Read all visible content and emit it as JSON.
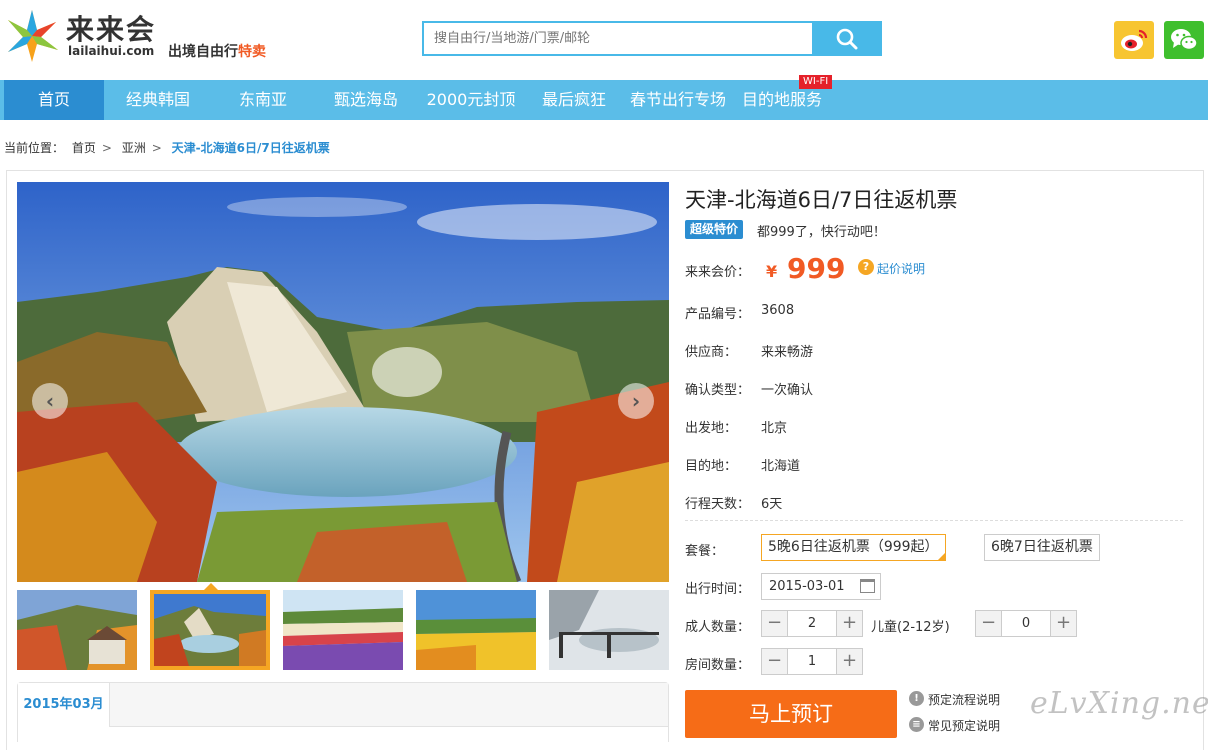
{
  "header": {
    "logo_cn": "来来会",
    "logo_en": "lailaihui.com",
    "slogan_prefix": "出境自由行",
    "slogan_hot": "特卖",
    "search_placeholder": "搜自由行/当地游/门票/邮轮",
    "search_icon": "search-icon",
    "social": [
      "weibo-icon",
      "wechat-icon"
    ]
  },
  "nav": {
    "items": [
      "首页",
      "经典韩国",
      "东南亚",
      "甄选海岛",
      "2000元封顶",
      "最后疯狂",
      "春节出行专场",
      "目的地服务"
    ],
    "active_index": 0,
    "wifi_badge": "WI-FI"
  },
  "breadcrumb": {
    "label": "当前位置：",
    "items": [
      "首页",
      "亚洲",
      "天津-北海道6日/7日往返机票"
    ],
    "sep": ">"
  },
  "product": {
    "title": "天津-北海道6日/7日往返机票",
    "badge": "超级特价",
    "promo": "都999了，快行动吧！",
    "price_label": "来来会价：",
    "price_currency": "¥",
    "price": "999",
    "price_help": "起价说明",
    "fields": [
      {
        "label": "产品编号：",
        "value": "3608"
      },
      {
        "label": "供应商：",
        "value": "来来畅游"
      },
      {
        "label": "确认类型：",
        "value": "一次确认"
      },
      {
        "label": "出发地：",
        "value": "北京"
      },
      {
        "label": "目的地：",
        "value": "北海道"
      },
      {
        "label": "行程天数：",
        "value": "6天"
      }
    ],
    "package_label": "套餐：",
    "packages": [
      "5晚6日往返机票（999起）",
      "6晚7日往返机票"
    ],
    "date_label": "出行时间：",
    "date_value": "2015-03-01",
    "adult_label": "成人数量：",
    "adult_count": "2",
    "child_label": "儿童(2-12岁)",
    "child_count": "0",
    "room_label": "房间数量：",
    "room_count": "1",
    "book_button": "马上预订",
    "links": [
      "预定流程说明",
      "常见预定说明"
    ]
  },
  "gallery": {
    "selected_thumb": 1,
    "thumb_count": 5
  },
  "calendar": {
    "month_tab": "2015年03月"
  },
  "watermark": "eLvXing.net",
  "colors": {
    "nav_bg": "#5bbde8",
    "nav_active": "#2b8dd1",
    "price": "#f15a24",
    "book_button": "#f66c17",
    "selected": "#f5a623"
  }
}
